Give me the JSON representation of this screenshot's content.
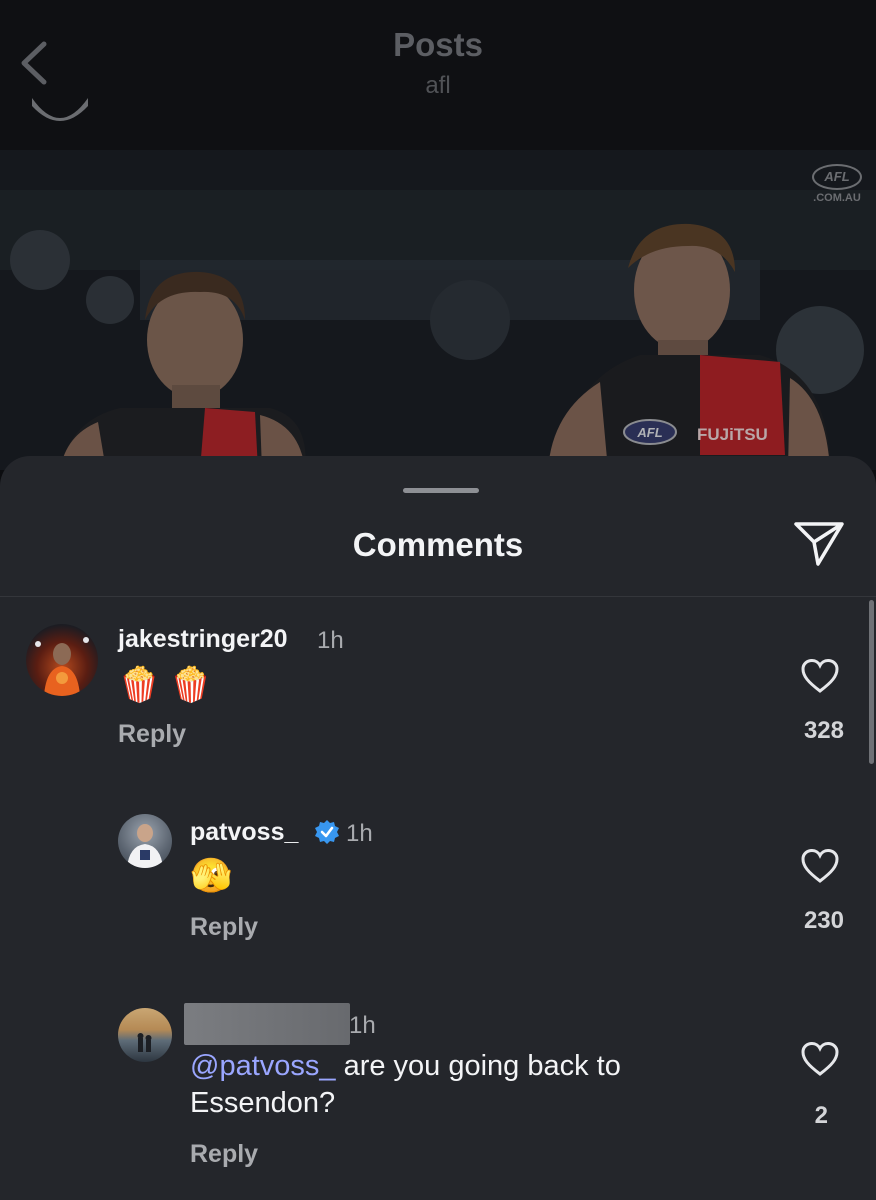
{
  "header": {
    "title": "Posts",
    "subtitle": "afl",
    "back_icon": "chevron-left-icon"
  },
  "post_image": {
    "watermark_logo": "AFL",
    "watermark_text": ".COM.AU",
    "jersey_logo": "AFL",
    "jersey_sponsor": "FUJiTSU"
  },
  "comments_sheet": {
    "title": "Comments",
    "share_icon": "send-icon",
    "comments": [
      {
        "username": "jakestringer20",
        "time": "1h",
        "text": "🍿 🍿",
        "reply_label": "Reply",
        "likes": "328",
        "verified": false
      },
      {
        "username": "patvoss_",
        "time": "1h",
        "text": "🫣",
        "reply_label": "Reply",
        "likes": "230",
        "verified": true
      },
      {
        "username": "",
        "time": "1h",
        "mention": "@patvoss_",
        "text": " are you going back to Essendon?",
        "reply_label": "Reply",
        "likes": "2",
        "verified": false
      }
    ]
  },
  "colors": {
    "sheet_bg": "#24262b",
    "mention": "#9aa6ff",
    "verified_badge": "#3897f0",
    "essendon_red": "#c8102e"
  }
}
